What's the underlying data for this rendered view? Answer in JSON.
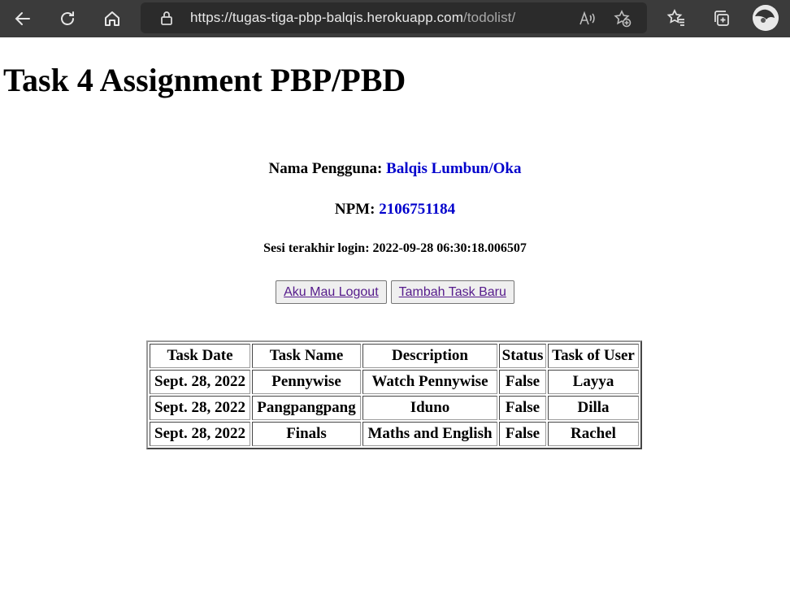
{
  "browser": {
    "url_host": "https://tugas-tiga-pbp-balqis.herokuapp.com",
    "url_path": "/todolist/"
  },
  "page": {
    "title": "Task 4 Assignment PBP/PBD",
    "user_label": "Nama Pengguna:",
    "user_value": "Balqis Lumbun/Oka",
    "npm_label": "NPM:",
    "npm_value": "2106751184",
    "last_login": "Sesi terakhir login: 2022-09-28 06:30:18.006507",
    "logout_label": "Aku Mau Logout",
    "add_task_label": "Tambah Task Baru"
  },
  "table": {
    "headers": [
      "Task Date",
      "Task Name",
      "Description",
      "Status",
      "Task of User"
    ],
    "rows": [
      [
        "Sept. 28, 2022",
        "Pennywise",
        "Watch Pennywise",
        "False",
        "Layya"
      ],
      [
        "Sept. 28, 2022",
        "Pangpangpang",
        "Iduno",
        "False",
        "Dilla"
      ],
      [
        "Sept. 28, 2022",
        "Finals",
        "Maths and English",
        "False",
        "Rachel"
      ]
    ]
  }
}
